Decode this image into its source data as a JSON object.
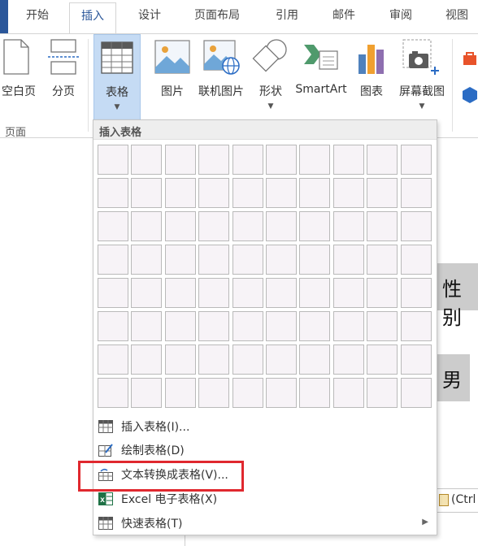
{
  "tabs": [
    {
      "label": "开始",
      "active": false
    },
    {
      "label": "插入",
      "active": true
    },
    {
      "label": "设计",
      "active": false
    },
    {
      "label": "页面布局",
      "active": false
    },
    {
      "label": "引用",
      "active": false
    },
    {
      "label": "邮件",
      "active": false
    },
    {
      "label": "审阅",
      "active": false
    },
    {
      "label": "视图",
      "active": false
    }
  ],
  "ribbon": {
    "blank_page": "空白页",
    "page_break": "分页",
    "table": "表格",
    "picture": "图片",
    "online_picture": "联机图片",
    "shapes": "形状",
    "smartart": "SmartArt",
    "chart": "图表",
    "screenshot": "屏幕截图",
    "group_pages": "页面"
  },
  "dropdown": {
    "header": "插入表格",
    "grid_rows": 8,
    "grid_cols": 10,
    "items": [
      {
        "label": "插入表格(I)...",
        "icon": "insert-table-icon"
      },
      {
        "label": "绘制表格(D)",
        "icon": "draw-table-icon"
      },
      {
        "label": "文本转换成表格(V)...",
        "icon": "text-to-table-icon"
      },
      {
        "label": "Excel 电子表格(X)",
        "icon": "excel-icon"
      },
      {
        "label": "快速表格(T)",
        "icon": "quick-table-icon"
      }
    ]
  },
  "document": {
    "cell_gender_header": "性别",
    "cell_gender_value": "男",
    "paste_options": "(Ctrl"
  },
  "colors": {
    "accent": "#2b579a",
    "highlight": "#e0282e"
  }
}
